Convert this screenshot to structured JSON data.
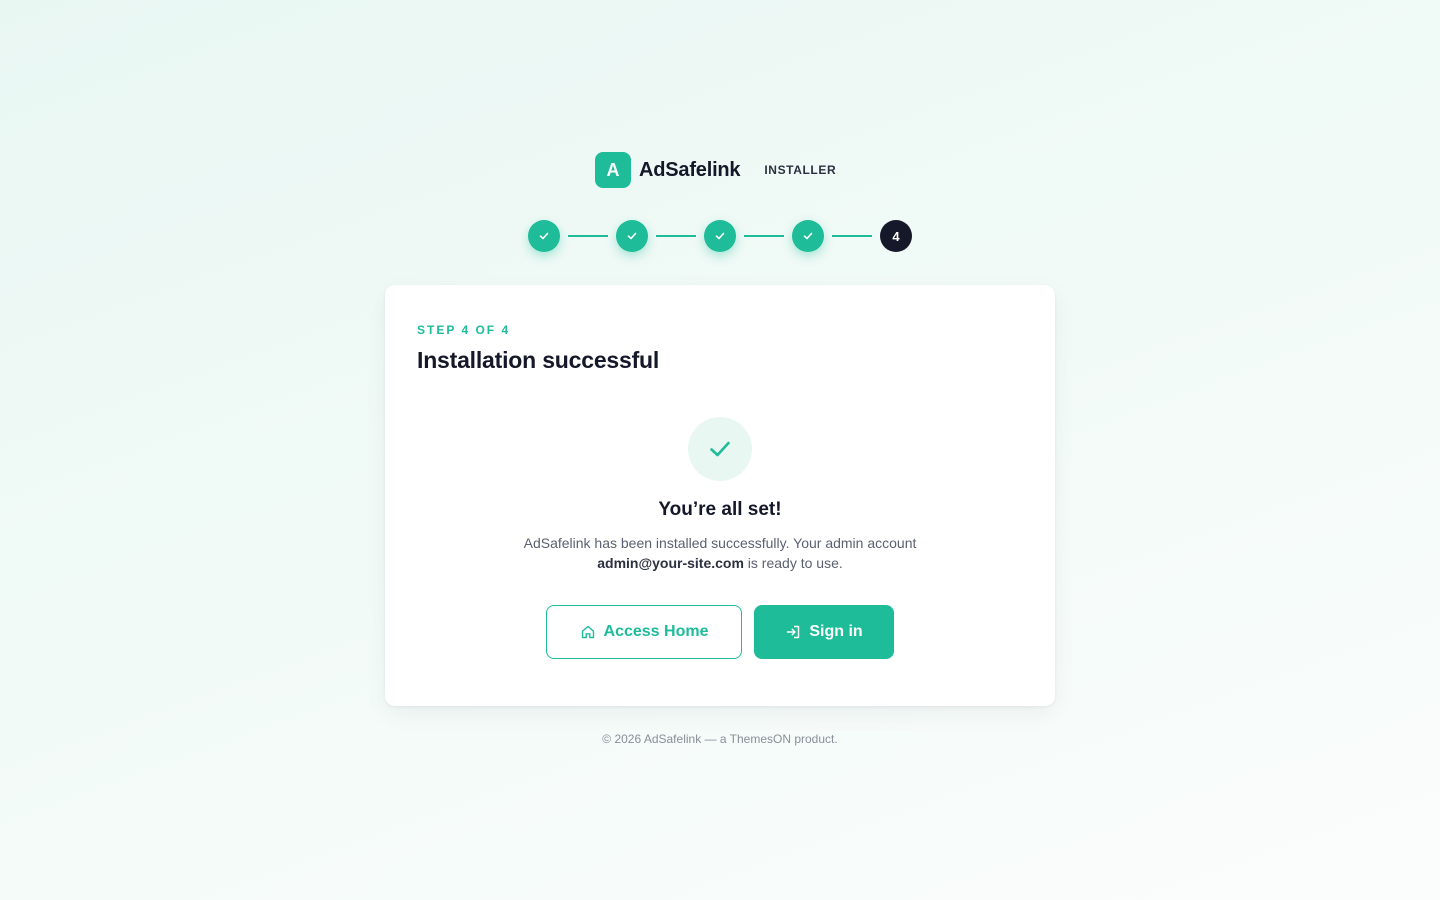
{
  "brand": {
    "logo_letter": "A",
    "name": "AdSafelink",
    "tag": "INSTALLER"
  },
  "stepper": {
    "current_step": "4",
    "completed_steps": 4,
    "total_steps": 4
  },
  "card": {
    "eyebrow": "STEP 4 OF 4",
    "title": "Installation successful",
    "heading": "You’re all set!",
    "description_line1": "AdSafelink has been installed successfully. Your admin account",
    "admin_email": "admin@your-site.com",
    "description_line2_suffix": " is ready to use."
  },
  "actions": {
    "home_label": "Access Home",
    "home_icon": "home-icon",
    "signin_label": "Sign in",
    "signin_icon": "sign-in-icon"
  },
  "footer": {
    "text": "© 2026 AdSafelink — a ThemesON product."
  },
  "colors": {
    "accent": "#1ebc99",
    "dark": "#141829",
    "muted": "#5b6170"
  }
}
